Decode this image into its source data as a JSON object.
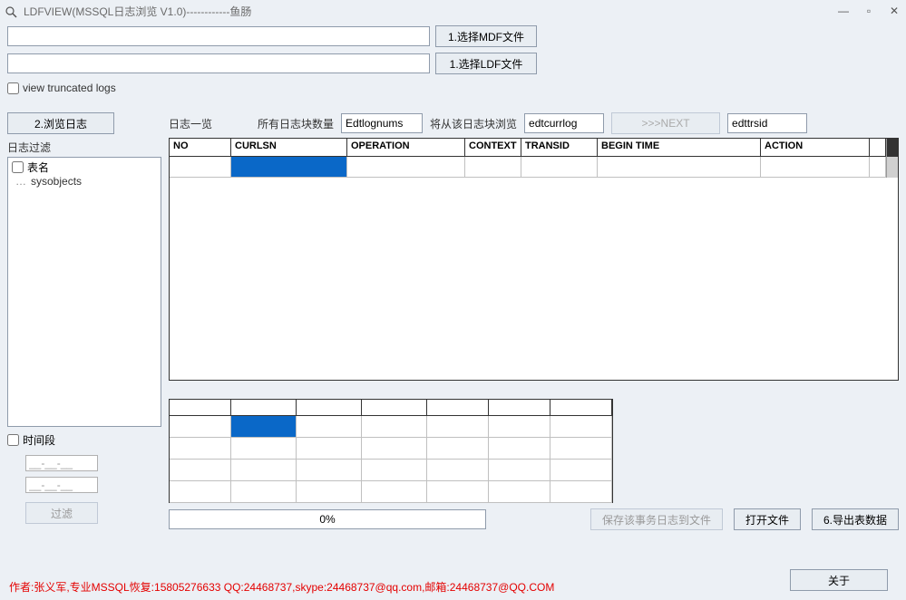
{
  "window": {
    "title": "LDFVIEW(MSSQL日志浏览 V1.0)------------鱼肠"
  },
  "fileSelect": {
    "mdf_input": "",
    "ldf_input": "",
    "btn_mdf": "1.选择MDF文件",
    "btn_ldf": "1.选择LDF文件"
  },
  "viewTruncated": {
    "label": "view truncated logs",
    "checked": false
  },
  "left": {
    "btn_browse": "2.浏览日志",
    "filter_label": "日志过滤",
    "table_label": "表名",
    "tree_item": "sysobjects",
    "time_label": "时间段",
    "date1": "__-__-__",
    "date2": "__-__-__",
    "btn_filter": "过滤"
  },
  "toolbar": {
    "list_label": "日志一览",
    "block_count_label": "所有日志块数量",
    "lognums": "Edtlognums",
    "from_block_label": "将从该日志块浏览",
    "currlog": "edtcurrlog",
    "btn_next": ">>>NEXT",
    "trsid": "edttrsid"
  },
  "grid1": {
    "headers": {
      "no": "NO",
      "curlsn": "CURLSN",
      "operation": "OPERATION",
      "context": "CONTEXT",
      "transid": "TRANSID",
      "begintime": "BEGIN TIME",
      "action": "ACTION"
    }
  },
  "progress": {
    "text": "0%"
  },
  "bottom": {
    "btn_save_trans": "保存该事务日志到文件",
    "btn_open_file": "打开文件",
    "btn_export": "6.导出表数据",
    "btn_about": "关于"
  },
  "footer": {
    "line1": "作者:张义军,专业MSSQL恢复:15805276633 QQ:24468737,skype:24468737@qq.com,邮箱:24468737@QQ.COM",
    "line2": ""
  }
}
